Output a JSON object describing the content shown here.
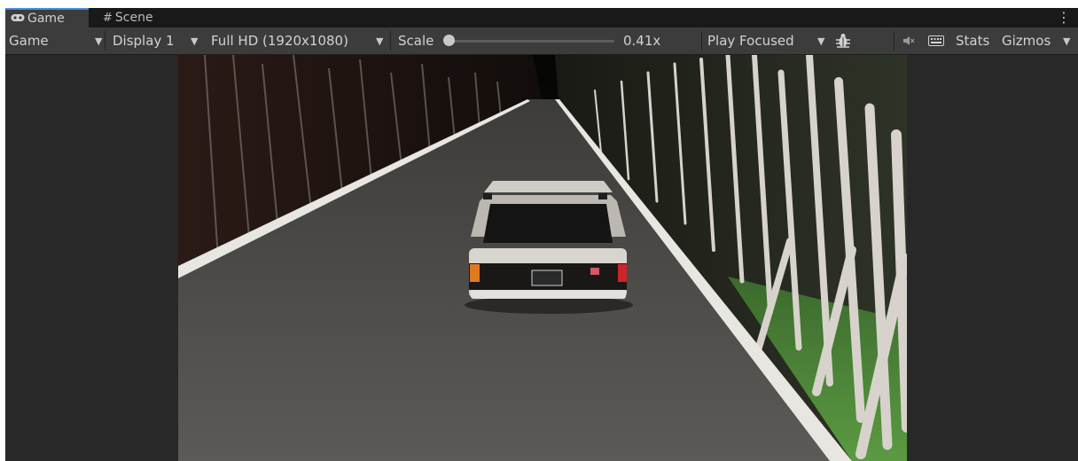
{
  "tabs": {
    "game_label": "Game",
    "scene_label": "Scene",
    "menu_glyph": "⋮"
  },
  "toolbar": {
    "mode_label": "Game",
    "display_label": "Display 1",
    "resolution_label": "Full HD (1920x1080)",
    "scale_label": "Scale",
    "scale_value_text": "0.41x",
    "scale_value": 0.41,
    "scale_slider_fraction": 0.02,
    "play_mode_label": "Play Focused",
    "stats_label": "Stats",
    "gizmos_label": "Gizmos"
  },
  "icons": {
    "game_tab": "gamepad-icon",
    "scene_tab": "hash-icon",
    "bug": "bug-icon",
    "audio": "mute-audio-icon",
    "keyboard": "keyboard-icon",
    "menu": "kebab-menu-icon"
  },
  "colors": {
    "panel_bg": "#282828",
    "toolbar_bg": "#3c3c3c",
    "tabbar_bg": "#191919",
    "active_tab_accent": "#4a90d9",
    "road": "#5a5856",
    "road_edge": "#e8e6e0",
    "car_body": "#d8d5cf",
    "grass": "#4f8a3a"
  }
}
